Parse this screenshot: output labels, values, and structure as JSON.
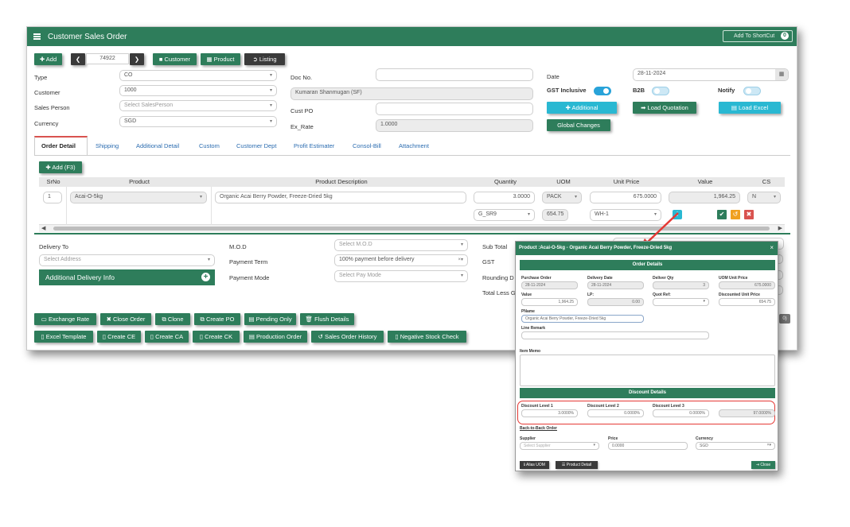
{
  "window": {
    "title": "Customer Sales Order",
    "shortcut_label": "Add To ShortCut",
    "shortcut_count": "0"
  },
  "toolbar": {
    "add": "Add",
    "order_no": "74922",
    "customer": "Customer",
    "product": "Product",
    "listing": "Listing"
  },
  "form": {
    "type_label": "Type",
    "type_value": "CO",
    "customer_label": "Customer",
    "customer_value": "1000",
    "salesperson_label": "Sales Person",
    "salesperson_placeholder": "Select SalesPerson",
    "currency_label": "Currency",
    "currency_value": "SGD",
    "docno_label": "Doc No.",
    "docno_value": "",
    "customer_name": "Kumaran Shanmugan (SF)",
    "custpo_label": "Cust PO",
    "custpo_value": "",
    "exrate_label": "Ex_Rate",
    "exrate_value": "1.0000",
    "date_label": "Date",
    "date_value": "28-11-2024",
    "gst_inclusive_label": "GST Inclusive",
    "b2b_label": "B2B",
    "notify_label": "Notify",
    "additional_btn": "Additional",
    "load_quotation_btn": "Load Quotation",
    "load_excel_btn": "Load Excel",
    "global_changes_btn": "Global Changes"
  },
  "toggles": {
    "gst_inclusive": true,
    "b2b": false,
    "notify": false
  },
  "tabs": [
    "Order Detail",
    "Shipping",
    "Additional Detail",
    "Custom",
    "Customer Dept",
    "Profit Estimater",
    "Consol-Bill",
    "Attachment"
  ],
  "grid": {
    "add_btn": "Add (F3)",
    "columns": [
      "SrNo",
      "Product",
      "Product Description",
      "Quantity",
      "UOM",
      "Unit Price",
      "Value",
      "CS"
    ],
    "row": {
      "srno": "1",
      "product": "Acai-O-5kg",
      "description": "Organic Acai Berry Powder, Freeze-Dried 5kg",
      "quantity": "3.0000",
      "uom": "PACK",
      "unit_price": "675.0000",
      "value": "1,964.25",
      "cs": "N",
      "tax_code": "G_SR9",
      "tax_amount": "654.75",
      "warehouse": "WH-1"
    }
  },
  "footer": {
    "delivery_to_label": "Delivery To",
    "delivery_to_placeholder": "Select Address",
    "additional_delivery_info": "Additional Delivery Info",
    "mod_label": "M.O.D",
    "mod_placeholder": "Select M.O.D",
    "payment_term_label": "Payment Term",
    "payment_term_value": "100% payment before delivery",
    "payment_mode_label": "Payment Mode",
    "payment_mode_placeholder": "Select Pay Mode",
    "subtotal_label": "Sub Total",
    "gst_label": "GST",
    "rounding_label": "Rounding D",
    "total_label": "Total Less G"
  },
  "action_row1": [
    "Exchange Rate",
    "Close Order",
    "Clone",
    "Create PO",
    "Pending Only",
    "Flush Details"
  ],
  "action_row2": [
    "Excel Template",
    "Create CE",
    "Create CA",
    "Create CK",
    "Production Order",
    "Sales Order History",
    "Negative Stock Check"
  ],
  "popup": {
    "title": "Product :Acai-O-5kg - Organic Acai Berry Powder, Freeze-Dried 5kg",
    "close": "×",
    "order_details": "Order Details",
    "purchase_order_label": "Purchase Order",
    "purchase_order_value": "28-11-2024",
    "delivery_date_label": "Delivery Date",
    "delivery_date_value": "28-11-2024",
    "delivery_qty_label": "Deliver Qty",
    "delivery_qty_value": "3",
    "uom_unit_price_label": "UOM Unit Price",
    "uom_unit_price_value": "675.0000",
    "value_label": "Value",
    "value_value": "1,964.25",
    "lp_label": "LP:",
    "lp_value": "0.00",
    "quot_ref_label": "Quot Ref:",
    "discounted_unit_price_label": "Discounted Unit Price",
    "discounted_unit_price_value": "654.75",
    "pname_label": "PName",
    "pname_value": "Organic Acai Berry Powder, Freeze-Dried 5kg",
    "line_remark_label": "Line Remark",
    "item_memo_label": "Item Memo",
    "discount_details": "Discount Details",
    "discount_level1_label": "Discount Level 1",
    "discount_level1_value": "3.0000%",
    "discount_level2_label": "Discount Level 2",
    "discount_level2_value": "0.0000%",
    "discount_level3_label": "Discount Level 3",
    "discount_level3_value": "0.0000%",
    "discount_total_value": "97.0000%",
    "back_to_back": "Back-to-Back Order",
    "supplier_label": "Supplier",
    "supplier_placeholder": "Select Supplier",
    "price_label": "Price",
    "price_value": "0.0000",
    "currency_label": "Currency",
    "currency_value": "SGD",
    "alias_uom_btn": "Alias UOM",
    "product_detail_btn": "Product Detail",
    "close_btn": "Close"
  },
  "colors": {
    "primary": "#2e7d5b",
    "accent": "#29b8d2",
    "highlight": "#e53935"
  }
}
